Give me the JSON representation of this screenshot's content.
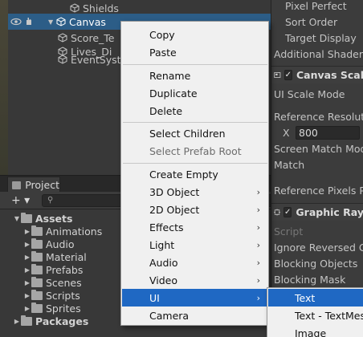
{
  "hierarchy": {
    "items": [
      {
        "label": "Shields"
      },
      {
        "label": "Canvas"
      },
      {
        "label": "Score_Te"
      },
      {
        "label": "Lives_Di"
      },
      {
        "label": "EventSyste"
      }
    ]
  },
  "project": {
    "tab_label": "Project",
    "add_label": "+ ▾",
    "search_placeholder": "",
    "root_label": "Assets",
    "folders": [
      "Animations",
      "Audio",
      "Material",
      "Prefabs",
      "Scenes",
      "Scripts",
      "Sprites"
    ],
    "packages_label": "Packages"
  },
  "inspector": {
    "rows": {
      "pixel_perfect": "Pixel Perfect",
      "sort_order": "Sort Order",
      "target_display": "Target Display",
      "additional_shader": "Additional Shader Cl",
      "canvas_scaler": "Canvas Scal",
      "ui_scale_mode": "UI Scale Mode",
      "reference_resolution": "Reference Resolutio",
      "x_label": "X",
      "x_value": "800",
      "screen_match_mode": "Screen Match Mode",
      "match": "Match",
      "reference_pixels": "Reference Pixels Pe",
      "graphic_raycaster": "Graphic Ray",
      "script": "Script",
      "ignore_reversed": "Ignore Reversed Gra",
      "blocking_objects": "Blocking Objects",
      "blocking_mask": "Blocking Mask"
    }
  },
  "context_menu": {
    "items": [
      {
        "label": "Copy"
      },
      {
        "label": "Paste"
      },
      {
        "label": "Rename"
      },
      {
        "label": "Duplicate"
      },
      {
        "label": "Delete"
      },
      {
        "label": "Select Children"
      },
      {
        "label": "Select Prefab Root"
      },
      {
        "label": "Create Empty"
      },
      {
        "label": "3D Object"
      },
      {
        "label": "2D Object"
      },
      {
        "label": "Effects"
      },
      {
        "label": "Light"
      },
      {
        "label": "Audio"
      },
      {
        "label": "Video"
      },
      {
        "label": "UI"
      },
      {
        "label": "Camera"
      }
    ],
    "chevron": "›"
  },
  "submenu": {
    "items": [
      {
        "label": "Text"
      },
      {
        "label": "Text - TextMeshPro"
      },
      {
        "label": "Image"
      }
    ]
  },
  "colors": {
    "selection": "#2c5d87",
    "menu_highlight": "#1f68c3",
    "menu_bg": "#f0f0f0",
    "panel_bg": "#383838"
  }
}
